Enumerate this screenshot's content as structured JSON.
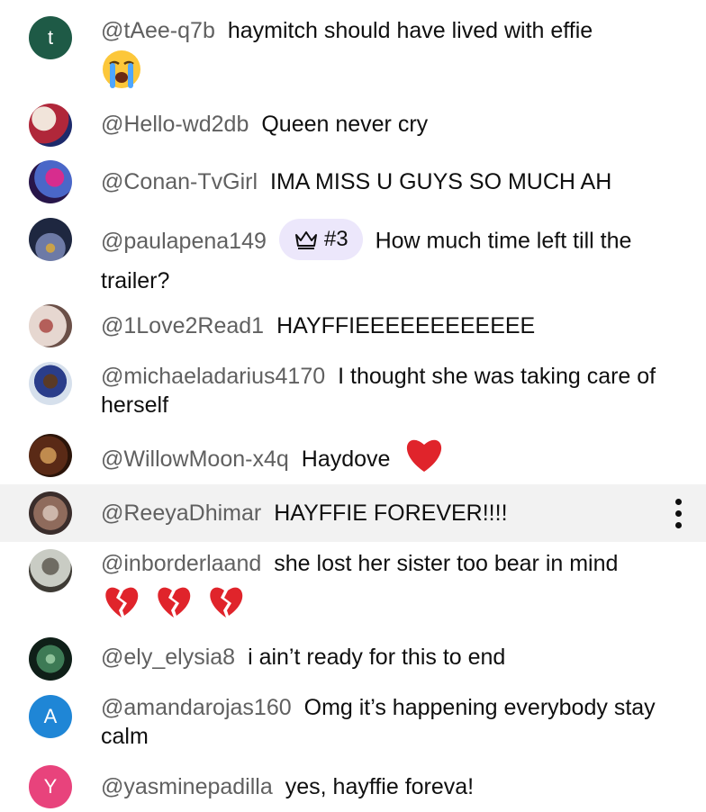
{
  "chat": {
    "messages": [
      {
        "author": "@tAee-q7b",
        "text": "haymitch should have lived with effie",
        "avatar": {
          "kind": "letter",
          "letter": "t",
          "color": "#1e5a46"
        },
        "emoji": [
          "loudly-crying-face"
        ]
      },
      {
        "author": "@Hello-wd2db",
        "text": "Queen never cry",
        "avatar": {
          "kind": "photo",
          "colors": [
            "#f1e4da",
            "#b0273a",
            "#1d2a6b"
          ]
        }
      },
      {
        "author": "@Conan-TvGirl",
        "text": "IMA MISS U GUYS SO MUCH AH",
        "avatar": {
          "kind": "photo",
          "colors": [
            "#28164a",
            "#d72d8e",
            "#4a67c8"
          ]
        }
      },
      {
        "author": "@paulapena149",
        "badge": "#3",
        "text": "How much time left till the trailer?",
        "avatar": {
          "kind": "photo",
          "colors": [
            "#1e2740",
            "#6d7aa6",
            "#c9a24a"
          ]
        }
      },
      {
        "author": "@1Love2Read1",
        "text": "HAYFFIEEEEEEEEEEEE",
        "avatar": {
          "kind": "photo",
          "colors": [
            "#e6d7d0",
            "#b45f5a",
            "#6b5048"
          ]
        }
      },
      {
        "author": "@michaeladarius4170",
        "text": "I thought she was taking care of herself",
        "avatar": {
          "kind": "photo",
          "colors": [
            "#d6e0ec",
            "#2a3d8a",
            "#5a3a26"
          ]
        }
      },
      {
        "author": "@WillowMoon-x4q",
        "text": "Haydove",
        "avatar": {
          "kind": "photo",
          "colors": [
            "#5a2a16",
            "#c08b4e",
            "#2b1409"
          ]
        },
        "emoji": [
          "red-heart"
        ]
      },
      {
        "author": "@ReeyaDhimar",
        "text": "HAYFFIE FOREVER!!!!",
        "avatar": {
          "kind": "photo",
          "colors": [
            "#3a2d2b",
            "#cdb7ab",
            "#8f6b5c"
          ]
        },
        "highlighted": true
      },
      {
        "author": "@inborderlaand",
        "text": "she lost her sister too bear in mind",
        "avatar": {
          "kind": "photo",
          "colors": [
            "#c9ccc4",
            "#6f6c63",
            "#3e3b35"
          ]
        },
        "emoji": [
          "broken-heart",
          "broken-heart",
          "broken-heart"
        ]
      },
      {
        "author": "@ely_elysia8",
        "text": "i ain’t ready for this to end",
        "avatar": {
          "kind": "photo",
          "colors": [
            "#0f1f18",
            "#3d7a55",
            "#8ec29a"
          ]
        }
      },
      {
        "author": "@amandarojas160",
        "text": "Omg it’s happening everybody stay calm",
        "avatar": {
          "kind": "letter",
          "letter": "A",
          "color": "#1f86d6"
        }
      },
      {
        "author": "@yasminepadilla",
        "text": "yes, hayffie foreva!",
        "avatar": {
          "kind": "letter",
          "letter": "Y",
          "color": "#e8437c"
        }
      }
    ]
  },
  "icons": {
    "badge": "crown-icon",
    "menu": "more-vert-icon"
  }
}
